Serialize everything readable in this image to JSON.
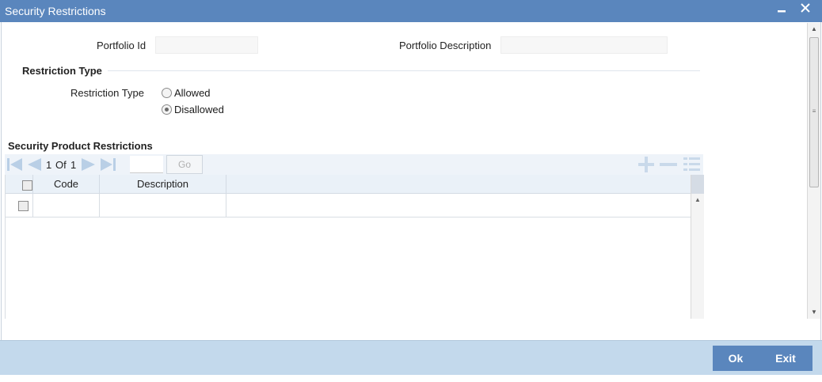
{
  "window": {
    "title": "Security Restrictions",
    "minimize_label": "▬",
    "close_label": "✕"
  },
  "fields": {
    "portfolio_id_label": "Portfolio Id",
    "portfolio_id_value": "",
    "portfolio_description_label": "Portfolio Description",
    "portfolio_description_value": ""
  },
  "restriction": {
    "section_title": "Restriction Type",
    "field_label": "Restriction Type",
    "options": [
      {
        "label": "Allowed",
        "selected": false
      },
      {
        "label": "Disallowed",
        "selected": true
      }
    ]
  },
  "grid": {
    "section_title": "Security Product Restrictions",
    "pager": {
      "current": "1",
      "of_label": "Of",
      "total": "1",
      "goto_value": "",
      "go_label": "Go"
    },
    "columns": [
      "Code",
      "Description"
    ],
    "rows": [
      {
        "code": "",
        "description": ""
      }
    ]
  },
  "footer": {
    "ok_label": "Ok",
    "exit_label": "Exit"
  },
  "colors": {
    "titlebar": "#5a86bd",
    "footer": "#c3d9ec",
    "button": "#5a86bd",
    "nav_icon": "#b9cfe6"
  },
  "icons": [
    "minimize-icon",
    "close-icon",
    "first-page-icon",
    "prev-page-icon",
    "next-page-icon",
    "last-page-icon",
    "add-row-icon",
    "delete-row-icon",
    "single-view-icon",
    "scroll-up-icon",
    "scroll-down-icon"
  ]
}
